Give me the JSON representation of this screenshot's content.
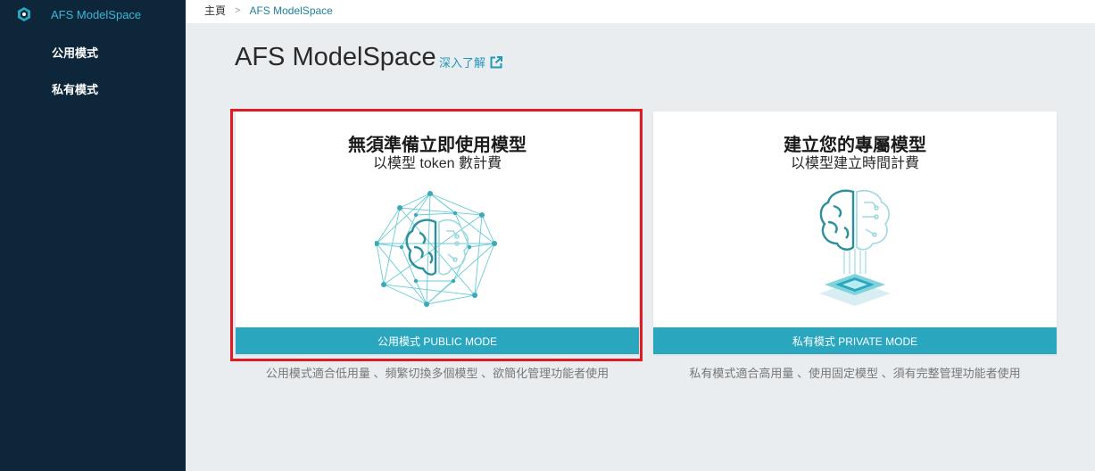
{
  "sidebar": {
    "brand": "AFS ModelSpace",
    "items": [
      {
        "label": "公用模式"
      },
      {
        "label": "私有模式"
      }
    ]
  },
  "breadcrumb": {
    "home": "主頁",
    "separator": ">",
    "current": "AFS ModelSpace"
  },
  "page": {
    "title": "AFS ModelSpace",
    "learn_more": "深入了解"
  },
  "cards": [
    {
      "title": "無須準備立即使用模型",
      "subtitle": "以模型 token 數計費",
      "button": "公用模式 PUBLIC MODE",
      "description": "公用模式適合低用量 、頻繁切換多個模型 、欲簡化管理功能者使用"
    },
    {
      "title": "建立您的專屬模型",
      "subtitle": "以模型建立時間計費",
      "button": "私有模式 PRIVATE MODE",
      "description": "私有模式適合高用量 、使用固定模型 、須有完整管理功能者使用"
    }
  ],
  "colors": {
    "sidebar_bg": "#0d2639",
    "accent": "#2aa6bf",
    "highlight": "#e01b24",
    "link": "#2396b8"
  },
  "icons": [
    "brand-logo-icon",
    "external-link-icon",
    "brain-network-icon",
    "brain-chip-icon"
  ]
}
